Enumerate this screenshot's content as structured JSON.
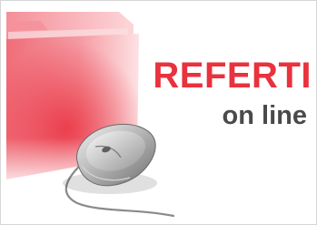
{
  "banner": {
    "title": "REFERTI",
    "subtitle": "on line"
  },
  "icons": {
    "folder": "folder-icon",
    "mouse": "computer-mouse-icon"
  },
  "colors": {
    "title": "#e8323e",
    "subtitle": "#4a4a4a",
    "folder_front": "#f27c86",
    "folder_back": "#f6a4ab",
    "folder_tab": "#f4929a",
    "mouse_body": "#a9a9a9",
    "mouse_highlight": "#e6e6e6",
    "border": "#d6d6d6"
  }
}
